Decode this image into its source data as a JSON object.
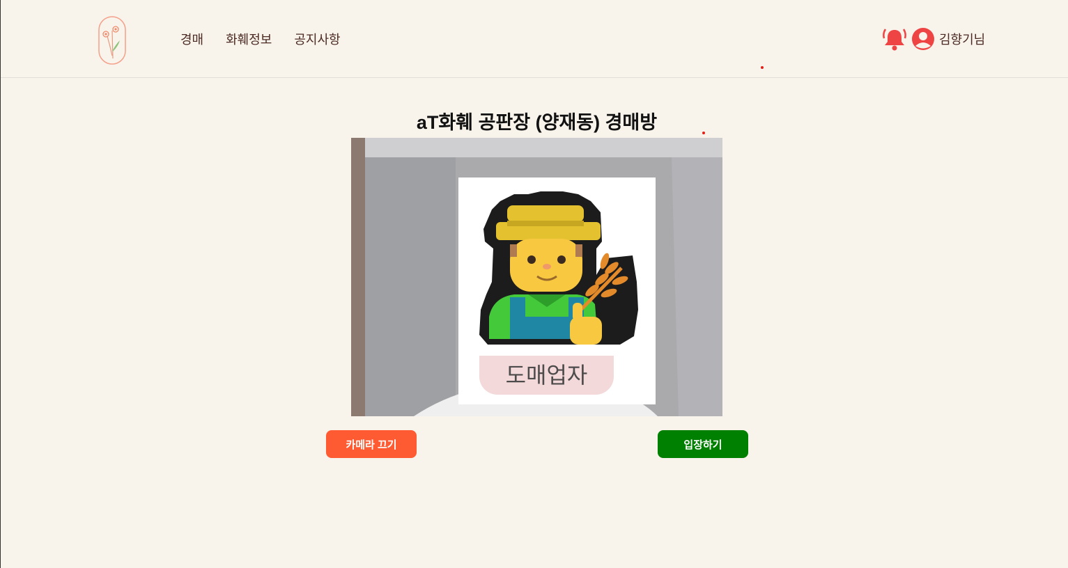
{
  "nav": {
    "links": [
      "경매",
      "화훼정보",
      "공지사항"
    ],
    "username": "김향기님"
  },
  "room": {
    "title": "aT화훼 공판장 (양재동) 경매방",
    "role_badge": "도매업자"
  },
  "buttons": {
    "camera_off": "카메라 끄기",
    "enter": "입장하기"
  },
  "colors": {
    "background": "#f8f3eb",
    "nav_text": "#4a2a22",
    "accent_red": "#ee4444",
    "camera_button": "#ff5b33",
    "enter_button": "#008000"
  },
  "icons": {
    "logo": "flower-logo",
    "notification": "bell-icon",
    "profile": "user-circle-icon",
    "avatar": "farmer-emoji"
  }
}
